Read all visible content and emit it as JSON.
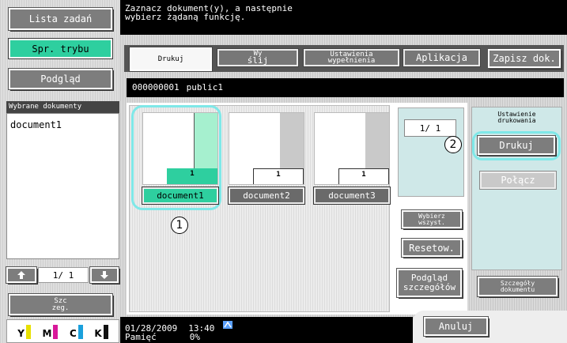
{
  "sidebar": {
    "task_list": "Lista zadań",
    "mode_check": "Spr. trybu",
    "preview": "Podgląd",
    "selected_header": "Wybrane dokumenty",
    "selected_item": "document1",
    "pager": "1/  1",
    "detail_line1": "Szc",
    "detail_line2": "zeg.",
    "toner": [
      "Y",
      "M",
      "C",
      "K"
    ]
  },
  "header": {
    "line1": "Zaznacz dokument(y), a następnie",
    "line2": "wybierz żądaną funkcję."
  },
  "tabs": [
    {
      "line1": "Drukuj",
      "line2": ""
    },
    {
      "line1": "Wy",
      "line2": "ślij"
    },
    {
      "line1": "Ustawienia",
      "line2": "wypełnienia"
    },
    {
      "line1": "Aplikacja",
      "line2": ""
    }
  ],
  "save_doc": "Zapisz dok.",
  "box": {
    "number": "000000001",
    "name": "public1"
  },
  "documents": [
    {
      "name": "document1",
      "pages": "1",
      "selected": true
    },
    {
      "name": "document2",
      "pages": "1",
      "selected": false
    },
    {
      "name": "document3",
      "pages": "1",
      "selected": false
    }
  ],
  "doc_pager": "1/  1",
  "actions": {
    "select_all_line1": "Wybierz",
    "select_all_line2": "wszyst.",
    "reset": "Resetow.",
    "preview_line1": "Podgląd",
    "preview_line2": "szczegółów"
  },
  "print_settings": {
    "title_line1": "Ustawienie",
    "title_line2": "drukowania",
    "print": "Drukuj",
    "combine": "Połącz",
    "doc_details_line1": "Szczegóły",
    "doc_details_line2": "dokumentu"
  },
  "callouts": [
    "1",
    "2"
  ],
  "status": {
    "date": "01/28/2009",
    "time": "13:40",
    "memory_label": "Pamięć",
    "memory_value": "0%"
  },
  "cancel": "Anuluj",
  "colors": {
    "accent": "#2ecf9f",
    "callout_ring": "#7fe8e8",
    "dark": "#000000"
  }
}
